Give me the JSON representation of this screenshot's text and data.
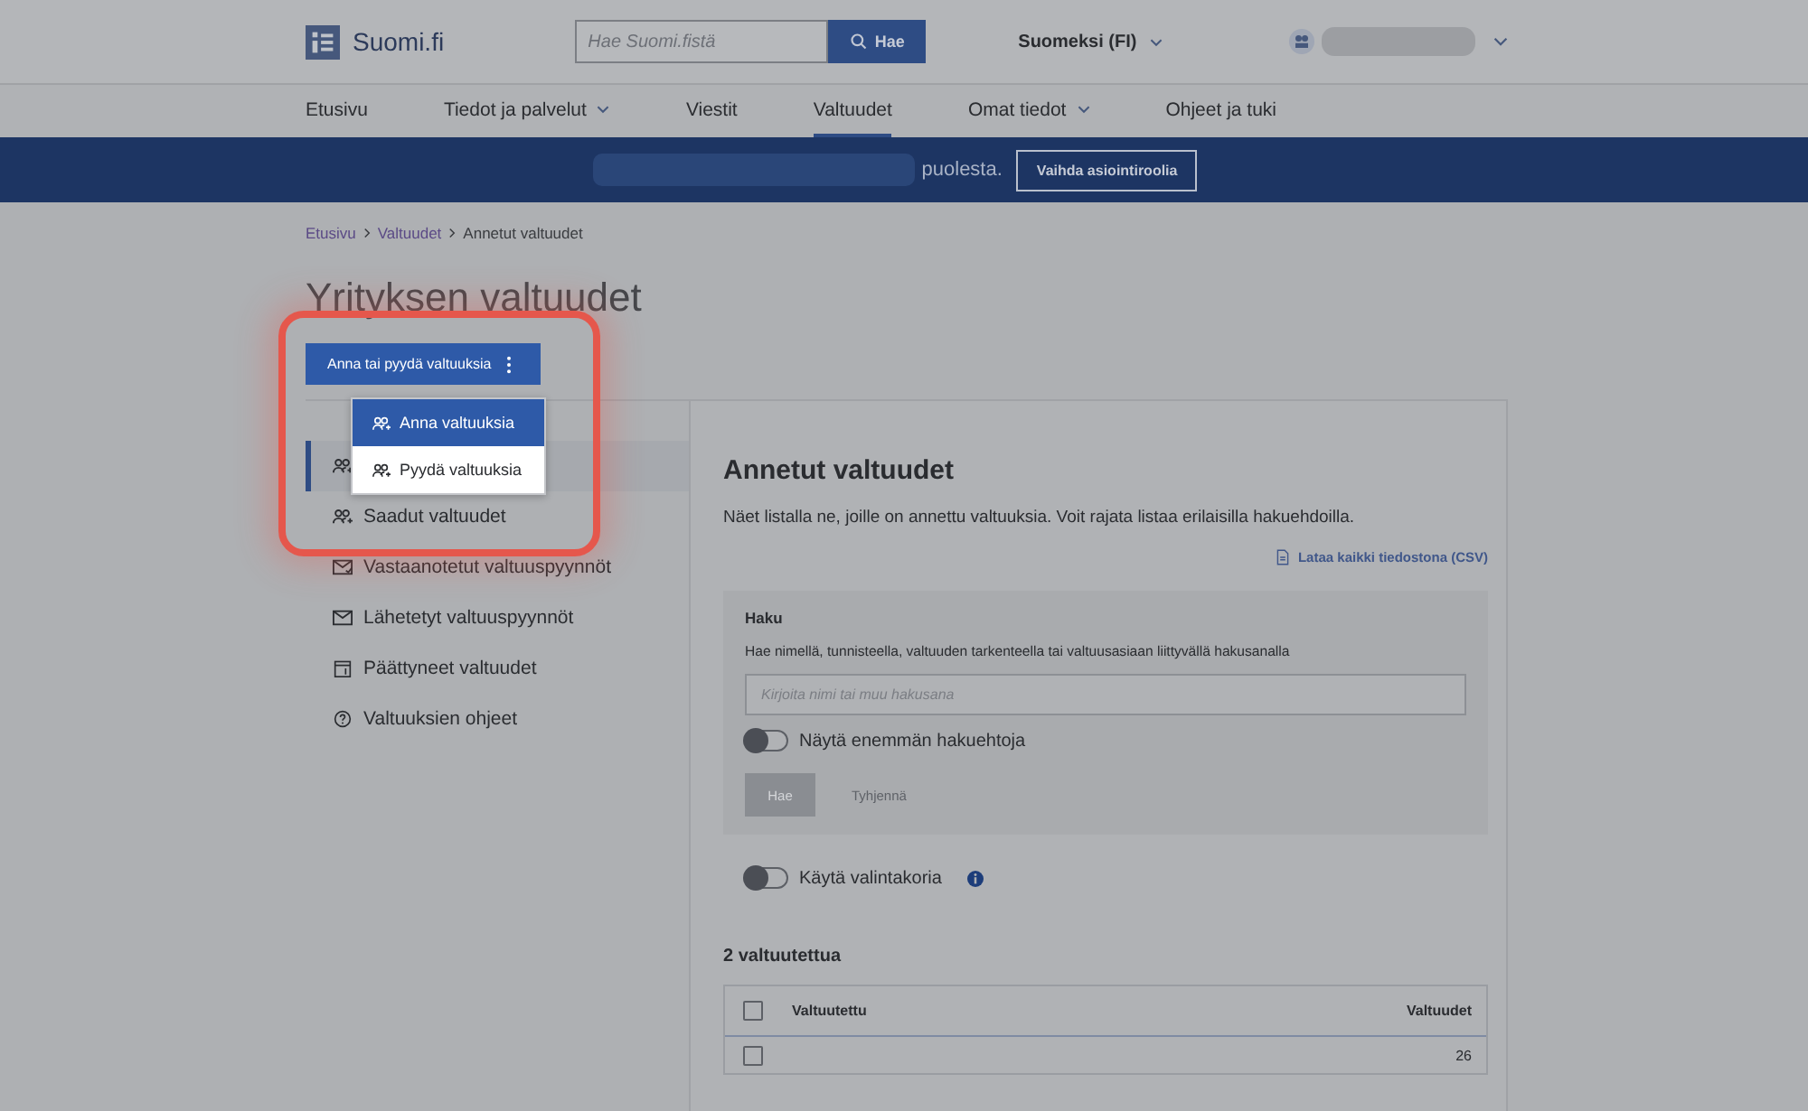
{
  "header": {
    "logo_text": "Suomi.fi",
    "search": {
      "placeholder": "Hae Suomi.fistä",
      "button": "Hae"
    },
    "language": "Suomeksi (FI)"
  },
  "nav": [
    {
      "label": "Etusivu",
      "has_menu": false,
      "selected": false
    },
    {
      "label": "Tiedot ja palvelut",
      "has_menu": true,
      "selected": false
    },
    {
      "label": "Viestit",
      "has_menu": false,
      "selected": false
    },
    {
      "label": "Valtuudet",
      "has_menu": false,
      "selected": true
    },
    {
      "label": "Omat tiedot",
      "has_menu": true,
      "selected": false
    },
    {
      "label": "Ohjeet ja tuki",
      "has_menu": false,
      "selected": false
    }
  ],
  "banner": {
    "text": "puolesta.",
    "button": "Vaihda asiointiroolia"
  },
  "breadcrumb": [
    {
      "label": "Etusivu",
      "link": true
    },
    {
      "label": "Valtuudet",
      "link": true
    },
    {
      "label": "Annetut valtuudet",
      "link": false
    }
  ],
  "title": "Yrityksen valtuudet",
  "action_button": "Anna tai pyydä valtuuksia",
  "dropdown": [
    {
      "label": "Anna valtuuksia",
      "selected": true
    },
    {
      "label": "Pyydä valtuuksia",
      "selected": false
    }
  ],
  "sidebar": [
    {
      "kind": "people",
      "selected": true
    },
    {
      "kind": "people",
      "label": "Saadut valtuudet",
      "selected": false
    },
    {
      "kind": "received",
      "label": "Vastaanotetut valtuuspyynnöt",
      "selected": false
    },
    {
      "kind": "sent",
      "label": "Lähetetyt valtuuspyynnöt",
      "selected": false
    },
    {
      "kind": "ended",
      "label": "Päättyneet valtuudet",
      "selected": false
    },
    {
      "kind": "help",
      "label": "Valtuuksien ohjeet",
      "selected": false
    }
  ],
  "main": {
    "heading": "Annetut valtuudet",
    "description": "Näet listalla ne, joille on annettu valtuuksia. Voit rajata listaa erilaisilla hakuehdoilla.",
    "download_link": "Lataa kaikki tiedostona (CSV)",
    "search_panel": {
      "title": "Haku",
      "hint": "Hae nimellä, tunnisteella, valtuuden tarkenteella tai valtuusasiaan liittyvällä hakusanalla",
      "placeholder": "Kirjoita nimi tai muu hakusana",
      "toggle": {
        "label": "Näytä enemmän hakuehtoja",
        "on": false
      },
      "buttons": [
        {
          "label": "Hae",
          "kind": "primary",
          "disabled": true
        },
        {
          "label": "Tyhjennä",
          "kind": "plain",
          "disabled": true
        }
      ]
    },
    "basket_toggle": {
      "label": "Käytä valintakoria",
      "on": false
    },
    "count": "2 valtuutettua",
    "table": {
      "checked": false,
      "columns": [
        "Valtuutettu",
        "Valtuudet"
      ],
      "rows": [
        {
          "checked": false,
          "cells": [
            "",
            "26"
          ]
        }
      ]
    }
  }
}
